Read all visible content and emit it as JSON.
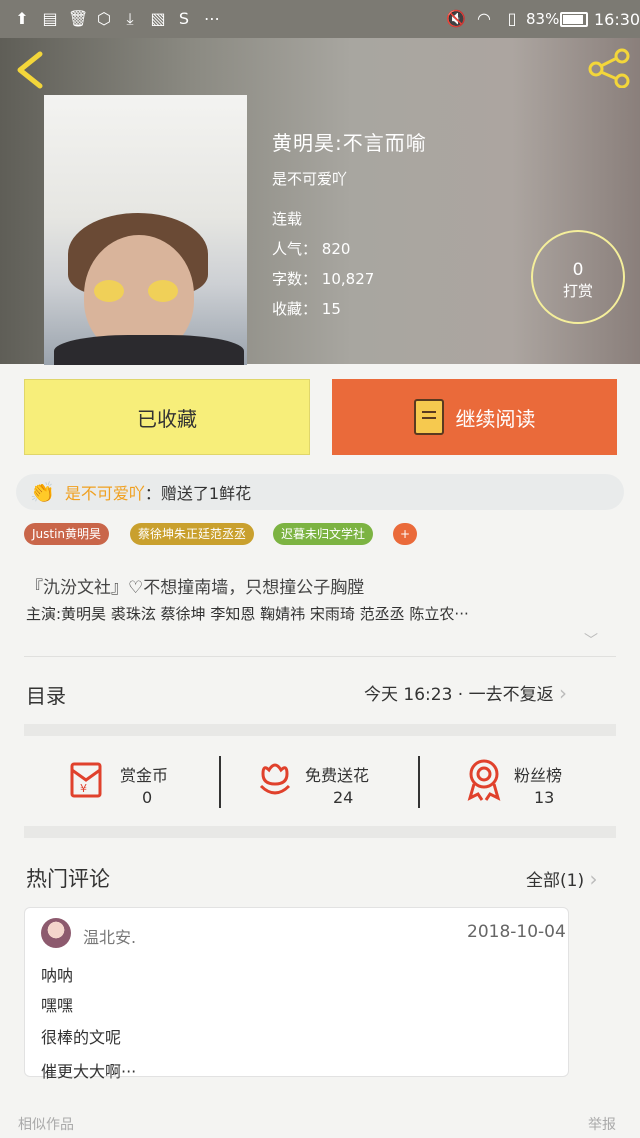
{
  "status_bar": {
    "battery": "83%",
    "time": "16:30"
  },
  "book": {
    "title": "黄明昊:不言而喻",
    "author": "是不可爱吖",
    "status": "连载",
    "popularity_label": "人气",
    "popularity": "820",
    "words_label": "字数",
    "words": "10,827",
    "favorites_label": "收藏",
    "favorites": "15"
  },
  "reward": {
    "count": "0",
    "label": "打赏"
  },
  "actions": {
    "collected": "已收藏",
    "continue": "继续阅读"
  },
  "gift_message": {
    "user": "是不可爱吖",
    "text": "：赠送了1鲜花"
  },
  "tags": [
    {
      "label": "Justin黄明昊",
      "color": "#c9664a"
    },
    {
      "label": "蔡徐坤朱正廷范丞丞",
      "color": "#c9a02e"
    },
    {
      "label": "迟暮未归文学社",
      "color": "#7cb342"
    },
    {
      "label": "+",
      "color": "#ea6a3a"
    }
  ],
  "description": {
    "line1": "『氿汾文社』♡不想撞南墙，只想撞公子胸膛",
    "line2": "主演:黄明昊 裘珠泫 蔡徐坤 李知恩 鞠婧祎 宋雨琦 范丞丞 陈立农···"
  },
  "toc": {
    "label": "目录",
    "update": "今天 16:23 · 一去不复返"
  },
  "stats": [
    {
      "label": "赏金币",
      "value": "0",
      "icon": "red-envelope-icon"
    },
    {
      "label": "免费送花",
      "value": "24",
      "icon": "flower-icon"
    },
    {
      "label": "粉丝榜",
      "value": "13",
      "icon": "medal-icon"
    }
  ],
  "comments_section": {
    "title": "热门评论",
    "all_label": "全部(1)"
  },
  "comment": {
    "user": "温北安.",
    "date": "2018-10-04",
    "lines": [
      "呐呐",
      "嘿嘿",
      "很棒的文呢",
      "催更大大啊···"
    ]
  },
  "footer": {
    "similar": "相似作品",
    "report": "举报"
  },
  "colors": {
    "accent_orange": "#ea6a3a",
    "accent_yellow": "#f7ee7a",
    "icon_red": "#e0412c"
  }
}
